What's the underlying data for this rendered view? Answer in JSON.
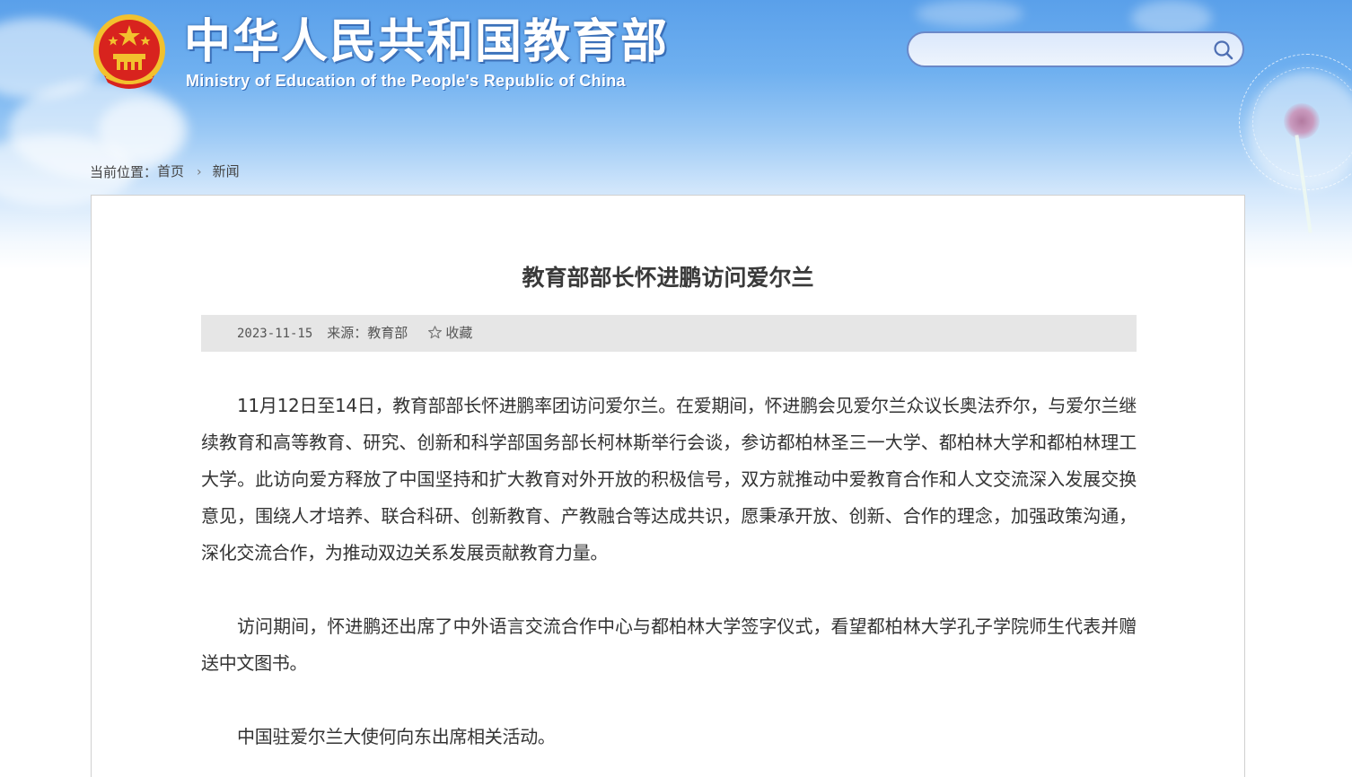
{
  "header": {
    "title_cn": "中华人民共和国教育部",
    "title_en": "Ministry of Education of the People's Republic of China",
    "emblem_icon": "national-emblem-icon",
    "colors": {
      "sky_top": "#5aa0ea",
      "emblem_red": "#d8231e",
      "emblem_gold": "#f2c12e"
    }
  },
  "search": {
    "placeholder": "",
    "value": "",
    "icon": "search-icon"
  },
  "breadcrumb": {
    "prefix": "当前位置：",
    "home": "首页",
    "separator": "›",
    "current": "新闻"
  },
  "article": {
    "title": "教育部部长怀进鹏访问爱尔兰",
    "date": "2023-11-15",
    "source": "来源：教育部",
    "collect_label": "收藏",
    "collect_icon": "star-icon",
    "paragraphs": [
      "11月12日至14日，教育部部长怀进鹏率团访问爱尔兰。在爱期间，怀进鹏会见爱尔兰众议长奥法乔尔，与爱尔兰继续教育和高等教育、研究、创新和科学部国务部长柯林斯举行会谈，参访都柏林圣三一大学、都柏林大学和都柏林理工大学。此访向爱方释放了中国坚持和扩大教育对外开放的积极信号，双方就推动中爱教育合作和人文交流深入发展交换意见，围绕人才培养、联合科研、创新教育、产教融合等达成共识，愿秉承开放、创新、合作的理念，加强政策沟通，深化交流合作，为推动双边关系发展贡献教育力量。",
      "访问期间，怀进鹏还出席了中外语言交流合作中心与都柏林大学签字仪式，看望都柏林大学孔子学院师生代表并赠送中文图书。",
      "中国驻爱尔兰大使何向东出席相关活动。"
    ]
  }
}
